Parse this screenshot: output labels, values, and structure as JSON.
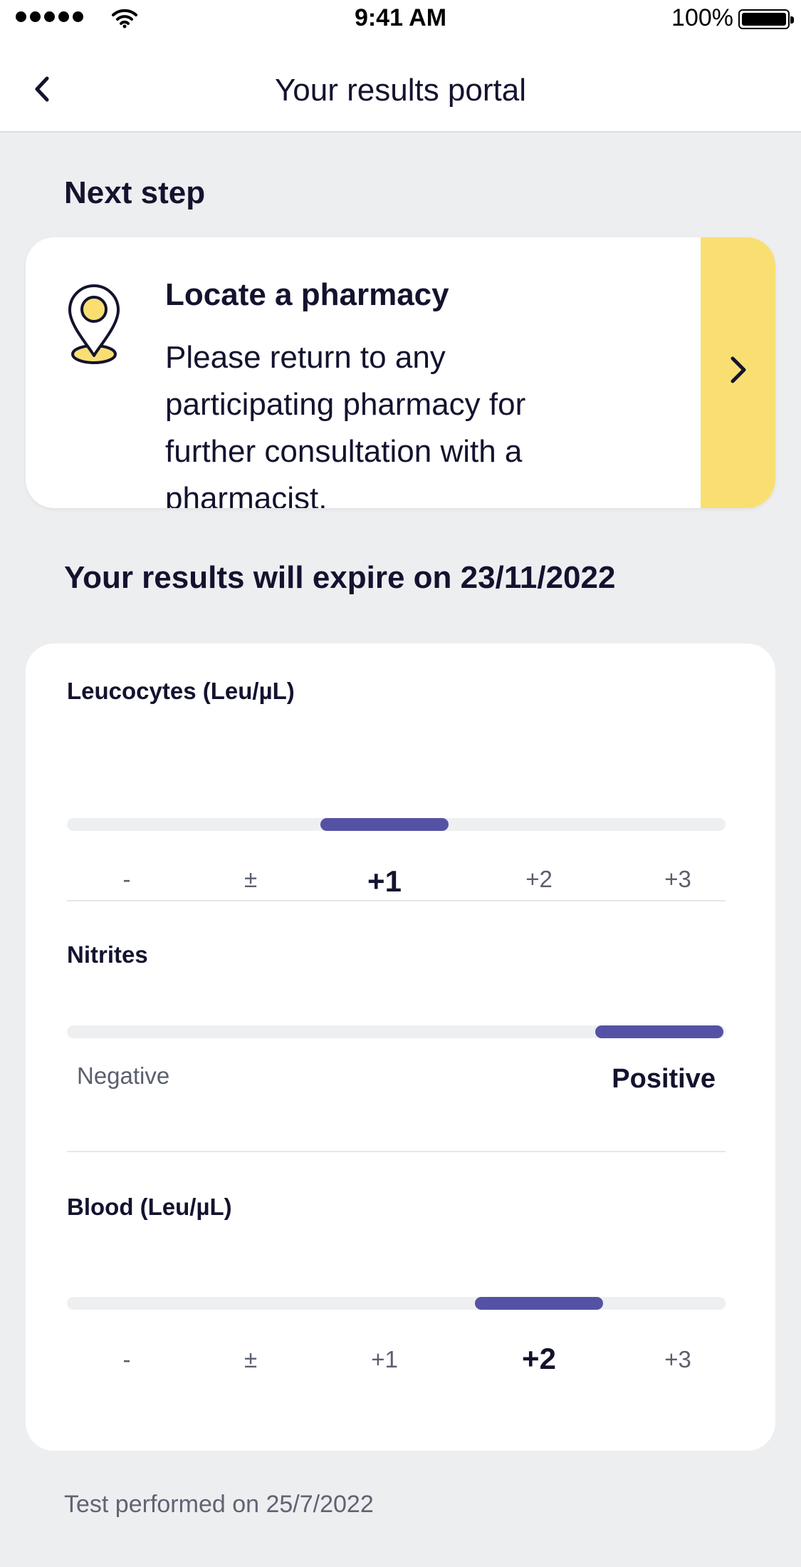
{
  "status_bar": {
    "time": "9:41 AM",
    "battery": "100%",
    "icons": [
      "signal-dots-icon",
      "wifi-icon",
      "battery-icon"
    ]
  },
  "nav": {
    "title": "Your results portal",
    "back_icon": "chevron-left-icon"
  },
  "next_step": {
    "heading": "Next step",
    "card": {
      "icon": "map-pin-icon",
      "title": "Locate a pharmacy",
      "description": "Please return to any participating pharmacy for further consultation with a pharmacist.",
      "arrow_icon": "chevron-right-icon",
      "accent_color": "#f9df72"
    }
  },
  "expiry": {
    "heading": "Your results will expire on 23/11/2022"
  },
  "results": {
    "accent_color": "#5552a5",
    "leucocytes": {
      "title": "Leucocytes (Leu/µL)",
      "scale": [
        "-",
        "±",
        "+1",
        "+2",
        "+3"
      ],
      "selected": "+1"
    },
    "nitrites": {
      "title": "Nitrites",
      "negative_label": "Negative",
      "positive_label": "Positive",
      "selected": "Positive"
    },
    "blood": {
      "title": "Blood (Leu/µL)",
      "scale": [
        "-",
        "±",
        "+1",
        "+2",
        "+3"
      ],
      "selected": "+2"
    }
  },
  "footer": {
    "text": "Test performed on 25/7/2022"
  }
}
